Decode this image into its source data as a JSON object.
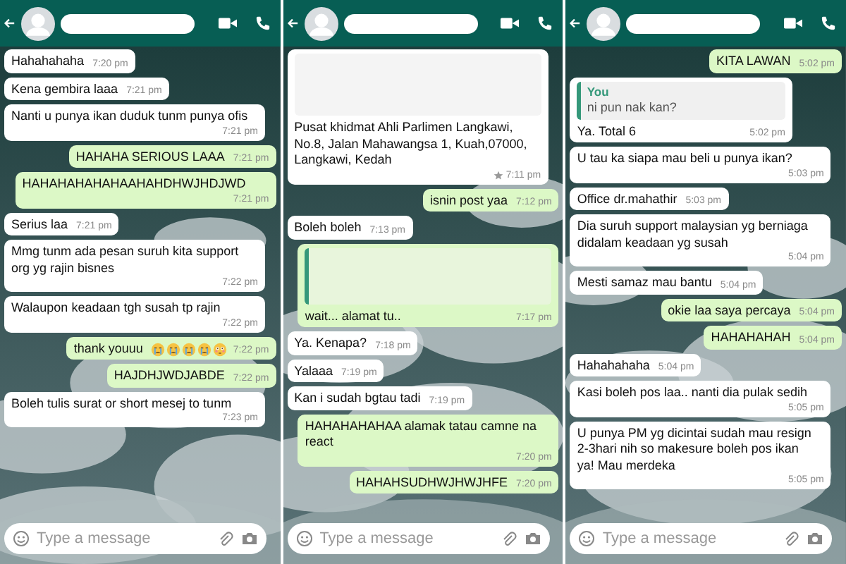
{
  "panels": [
    {
      "messages": [
        {
          "kind": "in",
          "text": "Hahahahaha",
          "time": "7:20 pm"
        },
        {
          "kind": "in",
          "text": "Kena gembira laaa",
          "time": "7:21 pm"
        },
        {
          "kind": "in",
          "text": "Nanti u punya ikan duduk tunm punya ofis",
          "time": "7:21 pm"
        },
        {
          "kind": "out",
          "text": "HAHAHA SERIOUS LAAA",
          "time": "7:21 pm"
        },
        {
          "kind": "out",
          "text": "HAHAHAHAHAHAAHAHDHWJHDJWD",
          "time": "7:21 pm"
        },
        {
          "kind": "in",
          "text": "Serius laa",
          "time": "7:21 pm"
        },
        {
          "kind": "in",
          "text": "Mmg tunm ada pesan suruh kita support org yg rajin bisnes",
          "time": "7:22 pm"
        },
        {
          "kind": "in",
          "text": "Walaupon keadaan tgh susah tp rajin",
          "time": "7:22 pm"
        },
        {
          "kind": "out-emoji",
          "text": "thank youuu",
          "time": "7:22 pm"
        },
        {
          "kind": "out",
          "text": "HAJDHJWDJABDE",
          "time": "7:22 pm"
        },
        {
          "kind": "in",
          "text": "Boleh tulis surat or short mesej to tunm",
          "time": "7:23 pm"
        }
      ],
      "placeholder": "Type a message"
    },
    {
      "messages": [
        {
          "kind": "in",
          "media": true,
          "text": "Pusat khidmat Ahli Parlimen Langkawi, No.8, Jalan Mahawangsa 1, Kuah,07000, Langkawi, Kedah",
          "starred": true,
          "time": "7:11 pm"
        },
        {
          "kind": "out",
          "text": "isnin post yaa",
          "time": "7:12 pm"
        },
        {
          "kind": "in",
          "text": "Boleh boleh",
          "time": "7:13 pm"
        },
        {
          "kind": "out",
          "quote": {
            "kind": "hidden"
          },
          "text": "wait... alamat tu..",
          "time": "7:17 pm"
        },
        {
          "kind": "in",
          "text": "Ya. Kenapa?",
          "time": "7:18 pm"
        },
        {
          "kind": "in",
          "text": "Yalaaa",
          "time": "7:19 pm"
        },
        {
          "kind": "in",
          "text": "Kan i sudah bgtau tadi",
          "time": "7:19 pm"
        },
        {
          "kind": "out",
          "text": "HAHAHAHAHAA alamak tatau camne na react",
          "time": "7:20 pm"
        },
        {
          "kind": "out",
          "text": "HAHAHSUDHWJHWJHFE",
          "time": "7:20 pm"
        }
      ],
      "placeholder": "Type a message"
    },
    {
      "messages": [
        {
          "kind": "out",
          "text": "KITA LAWAN",
          "time": "5:02 pm"
        },
        {
          "kind": "in",
          "quote": {
            "kind": "text",
            "author": "You",
            "text": "ni pun nak kan?"
          },
          "text": "Ya. Total 6",
          "time": "5:02 pm"
        },
        {
          "kind": "in",
          "text": "U tau ka siapa mau beli u punya ikan?",
          "time": "5:03 pm"
        },
        {
          "kind": "in",
          "text": "Office dr.mahathir",
          "time": "5:03 pm"
        },
        {
          "kind": "in",
          "text": "Dia suruh support malaysian yg berniaga didalam keadaan yg susah",
          "time": "5:04 pm"
        },
        {
          "kind": "in",
          "text": "Mesti samaz mau bantu",
          "time": "5:04 pm"
        },
        {
          "kind": "out",
          "text": "okie laa saya percaya",
          "time": "5:04 pm"
        },
        {
          "kind": "out",
          "text": "HAHAHAHAH",
          "time": "5:04 pm"
        },
        {
          "kind": "in",
          "text": "Hahahahaha",
          "time": "5:04 pm"
        },
        {
          "kind": "in",
          "text": "Kasi boleh pos laa.. nanti dia pulak sedih",
          "time": "5:05 pm"
        },
        {
          "kind": "in",
          "text": "U punya PM yg dicintai sudah mau resign 2-3hari nih so makesure boleh pos ikan ya! Mau merdeka",
          "time": "5:05 pm"
        }
      ],
      "placeholder": "Type a message"
    }
  ]
}
